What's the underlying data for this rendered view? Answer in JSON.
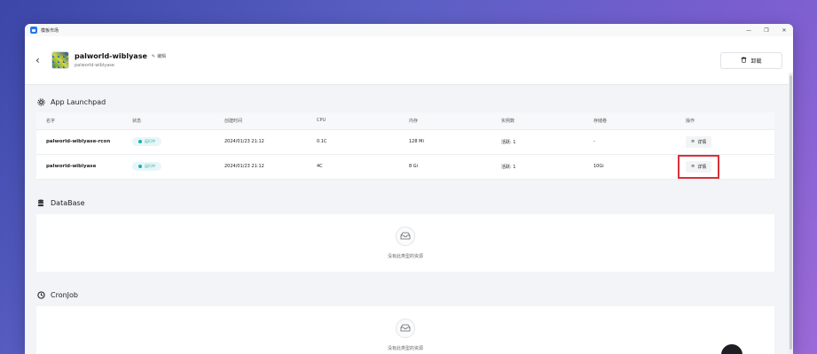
{
  "window": {
    "title": "模板市场"
  },
  "header": {
    "app_name": "palworld-wiblyase",
    "edit_label": "编辑",
    "subtitle": "palworld-wiblyase",
    "uninstall_label": "卸载"
  },
  "app_launchpad": {
    "title": "App Launchpad",
    "columns": [
      "名字",
      "状态",
      "创建时间",
      "CPU",
      "内存",
      "实例数",
      "存储卷",
      "操作"
    ],
    "rows": [
      {
        "name": "palworld-wiblyase-rcon",
        "status": "运行中",
        "created": "2024/01/23 21:12",
        "cpu": "0.1C",
        "memory": "128 Mi",
        "instances": "活跃: 1",
        "storage": "-",
        "action": "详情"
      },
      {
        "name": "palworld-wiblyase",
        "status": "运行中",
        "created": "2024/01/23 21:12",
        "cpu": "4C",
        "memory": "8 Gi",
        "instances": "活跃: 1",
        "storage": "10Gi",
        "action": "详情"
      }
    ]
  },
  "database": {
    "title": "DataBase",
    "empty_text": "没有此类型的资源"
  },
  "cronjob": {
    "title": "CronJob",
    "empty_text": "没有此类型的资源"
  },
  "colors": {
    "accent": "#2778e8",
    "status": "#19b0b3",
    "highlight": "#d9303a"
  }
}
